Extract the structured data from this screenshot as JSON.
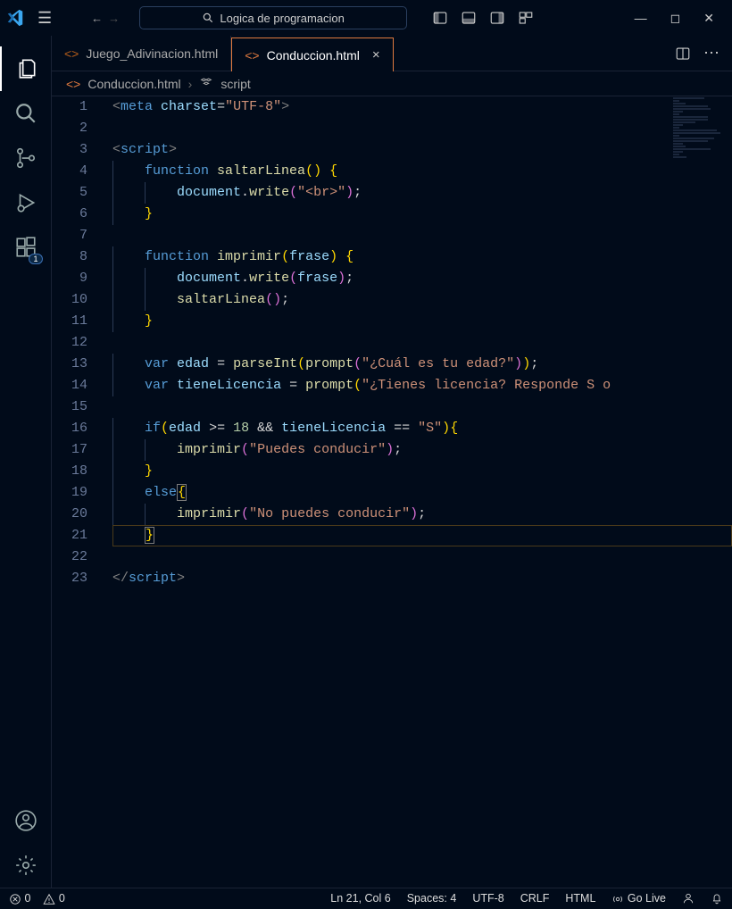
{
  "titlebar": {
    "search_text": "Logica de programacion"
  },
  "tabs": [
    {
      "label": "Juego_Adivinacion.html",
      "active": false
    },
    {
      "label": "Conduccion.html",
      "active": true
    }
  ],
  "breadcrumb": {
    "file": "Conduccion.html",
    "symbol": "script"
  },
  "code_lines": [
    {
      "n": 1,
      "tokens": [
        [
          "c-gray",
          "<"
        ],
        [
          "c-tag",
          "meta"
        ],
        [
          "c-punc",
          " "
        ],
        [
          "c-attr",
          "charset"
        ],
        [
          "c-punc",
          "="
        ],
        [
          "c-str",
          "\"UTF-8\""
        ],
        [
          "c-gray",
          ">"
        ]
      ]
    },
    {
      "n": 2,
      "tokens": []
    },
    {
      "n": 3,
      "tokens": [
        [
          "c-gray",
          "<"
        ],
        [
          "c-tag",
          "script"
        ],
        [
          "c-gray",
          ">"
        ]
      ]
    },
    {
      "n": 4,
      "indent": 1,
      "tokens": [
        [
          "c-kw",
          "function"
        ],
        [
          "c-punc",
          " "
        ],
        [
          "c-fn",
          "saltarLinea"
        ],
        [
          "c-brace-y",
          "()"
        ],
        [
          "c-punc",
          " "
        ],
        [
          "c-brace-y",
          "{"
        ]
      ]
    },
    {
      "n": 5,
      "indent": 2,
      "tokens": [
        [
          "c-var",
          "document"
        ],
        [
          "c-punc",
          "."
        ],
        [
          "c-fn",
          "write"
        ],
        [
          "c-brace-p",
          "("
        ],
        [
          "c-str",
          "\"<br>\""
        ],
        [
          "c-brace-p",
          ")"
        ],
        [
          "c-punc",
          ";"
        ]
      ]
    },
    {
      "n": 6,
      "indent": 1,
      "tokens": [
        [
          "c-brace-y",
          "}"
        ]
      ]
    },
    {
      "n": 7,
      "tokens": []
    },
    {
      "n": 8,
      "indent": 1,
      "tokens": [
        [
          "c-kw",
          "function"
        ],
        [
          "c-punc",
          " "
        ],
        [
          "c-fn",
          "imprimir"
        ],
        [
          "c-brace-y",
          "("
        ],
        [
          "c-var",
          "frase"
        ],
        [
          "c-brace-y",
          ")"
        ],
        [
          "c-punc",
          " "
        ],
        [
          "c-brace-y",
          "{"
        ]
      ]
    },
    {
      "n": 9,
      "indent": 2,
      "tokens": [
        [
          "c-var",
          "document"
        ],
        [
          "c-punc",
          "."
        ],
        [
          "c-fn",
          "write"
        ],
        [
          "c-brace-p",
          "("
        ],
        [
          "c-var",
          "frase"
        ],
        [
          "c-brace-p",
          ")"
        ],
        [
          "c-punc",
          ";"
        ]
      ]
    },
    {
      "n": 10,
      "indent": 2,
      "tokens": [
        [
          "c-fn",
          "saltarLinea"
        ],
        [
          "c-brace-p",
          "()"
        ],
        [
          "c-punc",
          ";"
        ]
      ]
    },
    {
      "n": 11,
      "indent": 1,
      "tokens": [
        [
          "c-brace-y",
          "}"
        ]
      ]
    },
    {
      "n": 12,
      "tokens": []
    },
    {
      "n": 13,
      "indent": 1,
      "tokens": [
        [
          "c-kw",
          "var"
        ],
        [
          "c-punc",
          " "
        ],
        [
          "c-var",
          "edad"
        ],
        [
          "c-punc",
          " = "
        ],
        [
          "c-fn",
          "parseInt"
        ],
        [
          "c-brace-y",
          "("
        ],
        [
          "c-fn",
          "prompt"
        ],
        [
          "c-brace-p",
          "("
        ],
        [
          "c-str",
          "\"¿Cuál es tu edad?\""
        ],
        [
          "c-brace-p",
          ")"
        ],
        [
          "c-brace-y",
          ")"
        ],
        [
          "c-punc",
          ";"
        ]
      ]
    },
    {
      "n": 14,
      "indent": 1,
      "tokens": [
        [
          "c-kw",
          "var"
        ],
        [
          "c-punc",
          " "
        ],
        [
          "c-var",
          "tieneLicencia"
        ],
        [
          "c-punc",
          " = "
        ],
        [
          "c-fn",
          "prompt"
        ],
        [
          "c-brace-y",
          "("
        ],
        [
          "c-str",
          "\"¿Tienes licencia? Responde S o"
        ]
      ]
    },
    {
      "n": 15,
      "tokens": []
    },
    {
      "n": 16,
      "indent": 1,
      "tokens": [
        [
          "c-kw",
          "if"
        ],
        [
          "c-brace-y",
          "("
        ],
        [
          "c-var",
          "edad"
        ],
        [
          "c-punc",
          " >= "
        ],
        [
          "c-num",
          "18"
        ],
        [
          "c-punc",
          " && "
        ],
        [
          "c-var",
          "tieneLicencia"
        ],
        [
          "c-punc",
          " == "
        ],
        [
          "c-str",
          "\"S\""
        ],
        [
          "c-brace-y",
          ")"
        ],
        [
          "c-brace-y",
          "{"
        ]
      ]
    },
    {
      "n": 17,
      "indent": 2,
      "tokens": [
        [
          "c-fn",
          "imprimir"
        ],
        [
          "c-brace-p",
          "("
        ],
        [
          "c-str",
          "\"Puedes conducir\""
        ],
        [
          "c-brace-p",
          ")"
        ],
        [
          "c-punc",
          ";"
        ]
      ]
    },
    {
      "n": 18,
      "indent": 1,
      "tokens": [
        [
          "c-brace-y",
          "}"
        ]
      ]
    },
    {
      "n": 19,
      "indent": 1,
      "tokens": [
        [
          "c-kw",
          "else"
        ],
        [
          "c-brace-y",
          "{"
        ]
      ],
      "boxlast": true
    },
    {
      "n": 20,
      "indent": 2,
      "tokens": [
        [
          "c-fn",
          "imprimir"
        ],
        [
          "c-brace-p",
          "("
        ],
        [
          "c-str",
          "\"No puedes conducir\""
        ],
        [
          "c-brace-p",
          ")"
        ],
        [
          "c-punc",
          ";"
        ]
      ]
    },
    {
      "n": 21,
      "indent": 1,
      "tokens": [
        [
          "c-brace-y",
          "}"
        ]
      ],
      "hl": true,
      "boxlast": true
    },
    {
      "n": 22,
      "tokens": []
    },
    {
      "n": 23,
      "tokens": [
        [
          "c-gray",
          "</"
        ],
        [
          "c-tag",
          "script"
        ],
        [
          "c-gray",
          ">"
        ]
      ]
    }
  ],
  "statusbar": {
    "errors": "0",
    "warnings": "0",
    "position": "Ln 21, Col 6",
    "spaces": "Spaces: 4",
    "encoding": "UTF-8",
    "eol": "CRLF",
    "language": "HTML",
    "golive": "Go Live"
  },
  "activitybar": {
    "badge": "1"
  }
}
